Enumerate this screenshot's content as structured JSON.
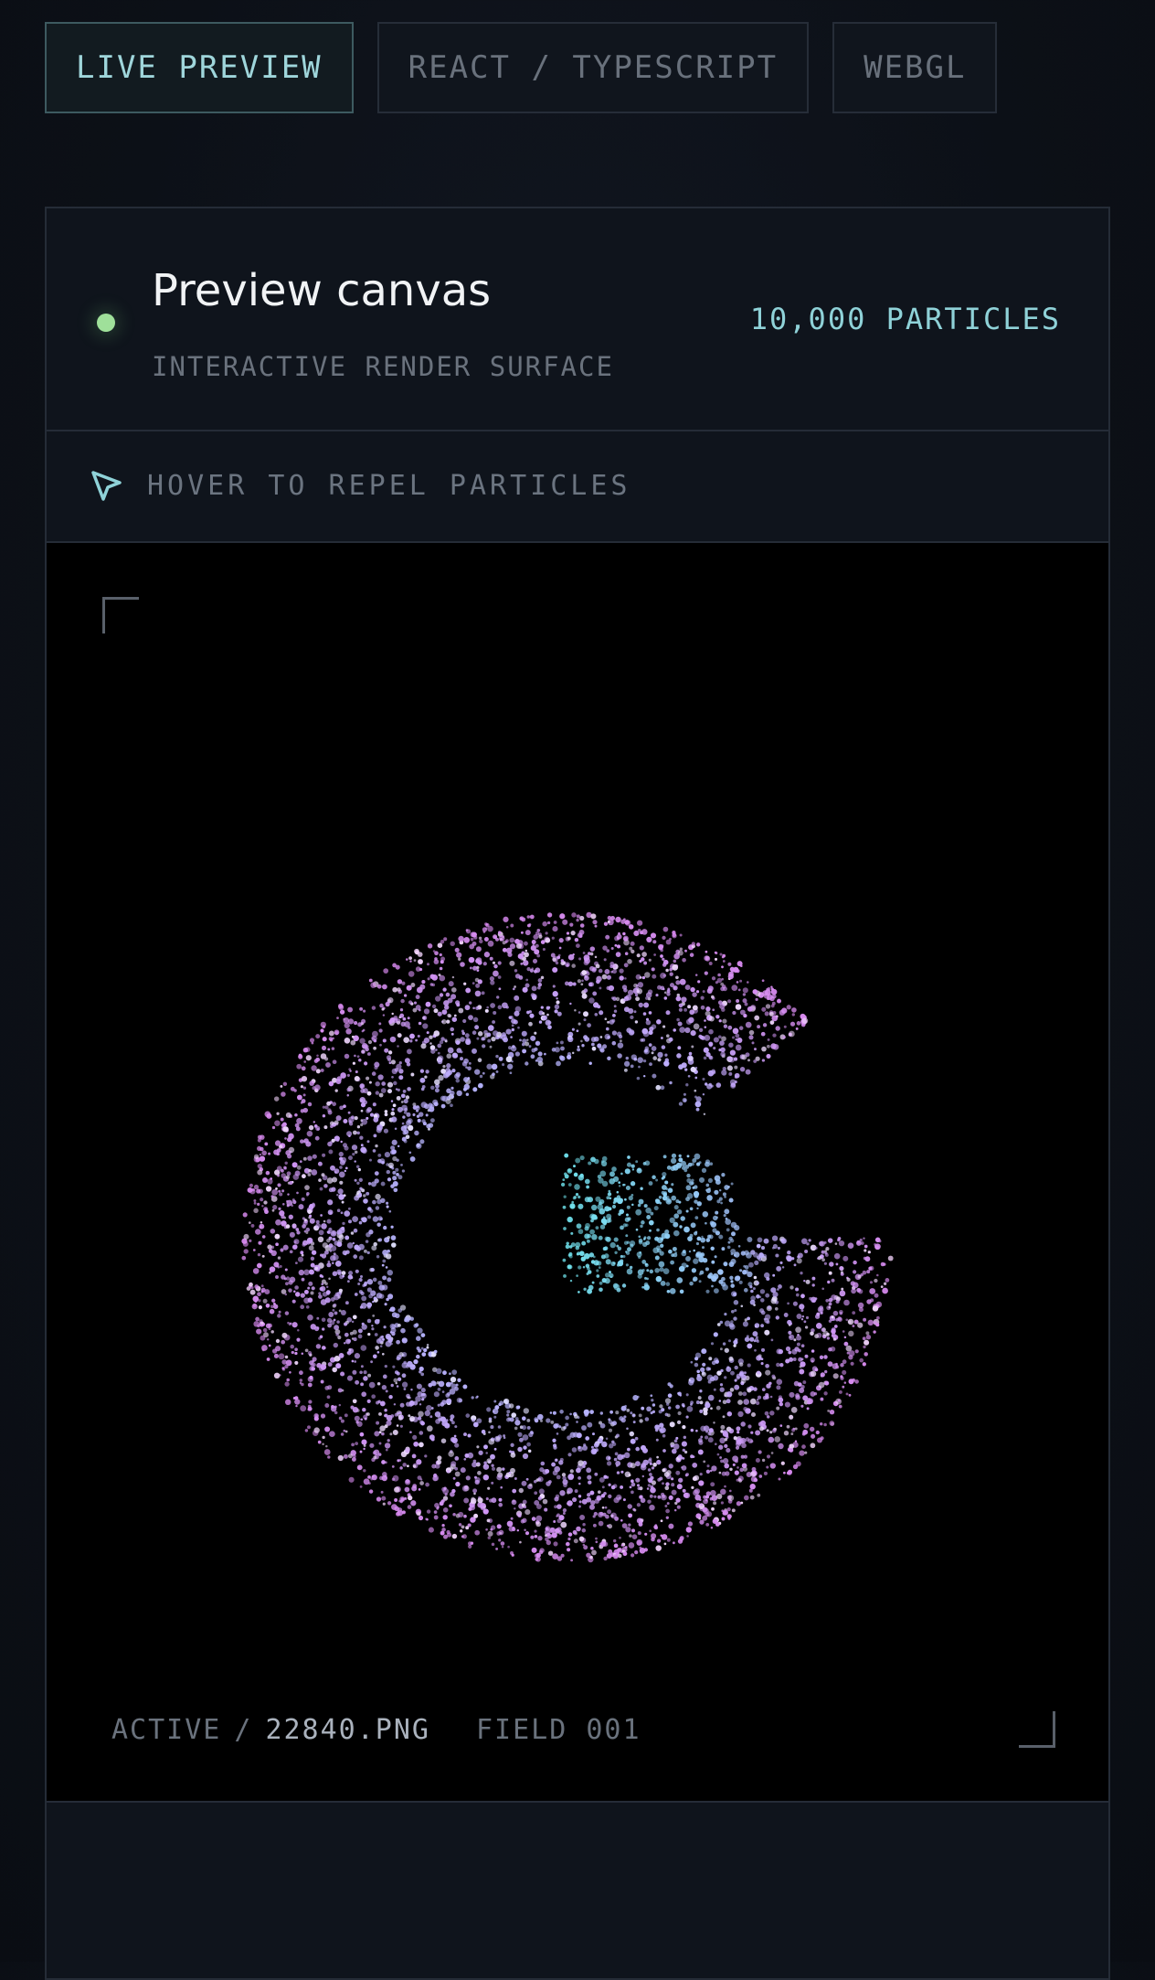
{
  "tabs": [
    {
      "label": "LIVE PREVIEW",
      "active": true
    },
    {
      "label": "REACT / TYPESCRIPT",
      "active": false
    },
    {
      "label": "WEBGL",
      "active": false
    }
  ],
  "panel": {
    "title": "Preview canvas",
    "subtitle": "INTERACTIVE RENDER SURFACE",
    "particle_count": "10,000 PARTICLES",
    "status_color": "#9fe09a"
  },
  "hint": {
    "icon": "cursor-pointer-icon",
    "text": "HOVER TO REPEL PARTICLES"
  },
  "canvas": {
    "glyph": "G",
    "colors": {
      "outer": "#d98af0",
      "mid": "#b7b5ff",
      "inner": "#6fe4ee"
    },
    "footer": {
      "state": "ACTIVE",
      "separator": "/",
      "file": "22840.PNG",
      "field": "FIELD 001"
    }
  }
}
